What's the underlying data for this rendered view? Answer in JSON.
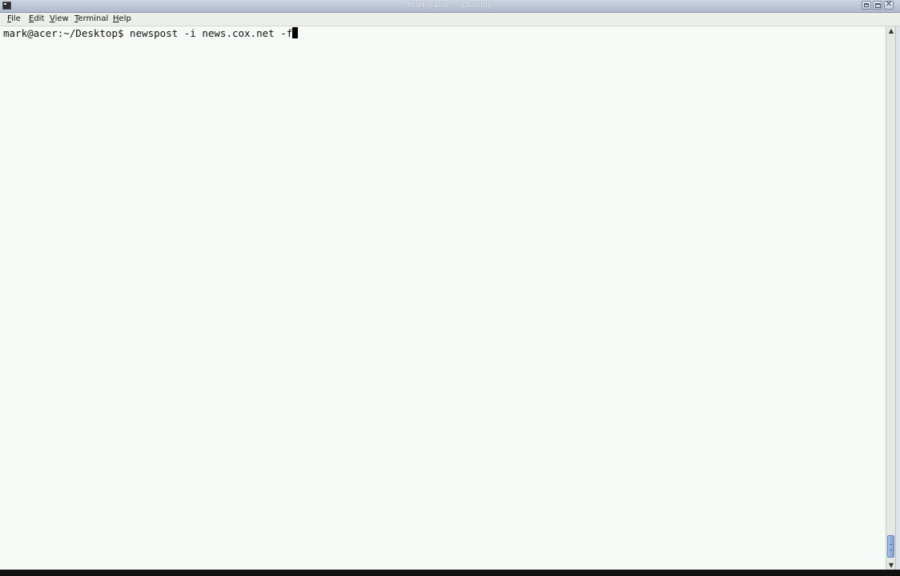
{
  "window": {
    "title": "mark@acer: ~/Desktop"
  },
  "menubar": {
    "items": [
      {
        "label": "File",
        "mnemonic": "F",
        "rest": "ile"
      },
      {
        "label": "Edit",
        "mnemonic": "E",
        "rest": "dit"
      },
      {
        "label": "View",
        "mnemonic": "V",
        "rest": "iew"
      },
      {
        "label": "Terminal",
        "mnemonic": "T",
        "rest": "erminal"
      },
      {
        "label": "Help",
        "mnemonic": "H",
        "rest": "elp"
      }
    ]
  },
  "terminal": {
    "prompt": "mark@acer:~/Desktop$ ",
    "command": "newspost -i news.cox.net -f"
  },
  "icons": {
    "app": "terminal-icon",
    "minimize": "minimize-icon",
    "maximize": "maximize-icon",
    "close": "close-icon",
    "scroll_up": "arrow-up-icon",
    "scroll_down": "arrow-down-icon"
  },
  "colors": {
    "terminal_bg": "#f6faf6",
    "terminal_fg": "#111111",
    "scroll_thumb": "#8fadd9"
  },
  "scroll": {
    "position_fraction": 1.0
  }
}
